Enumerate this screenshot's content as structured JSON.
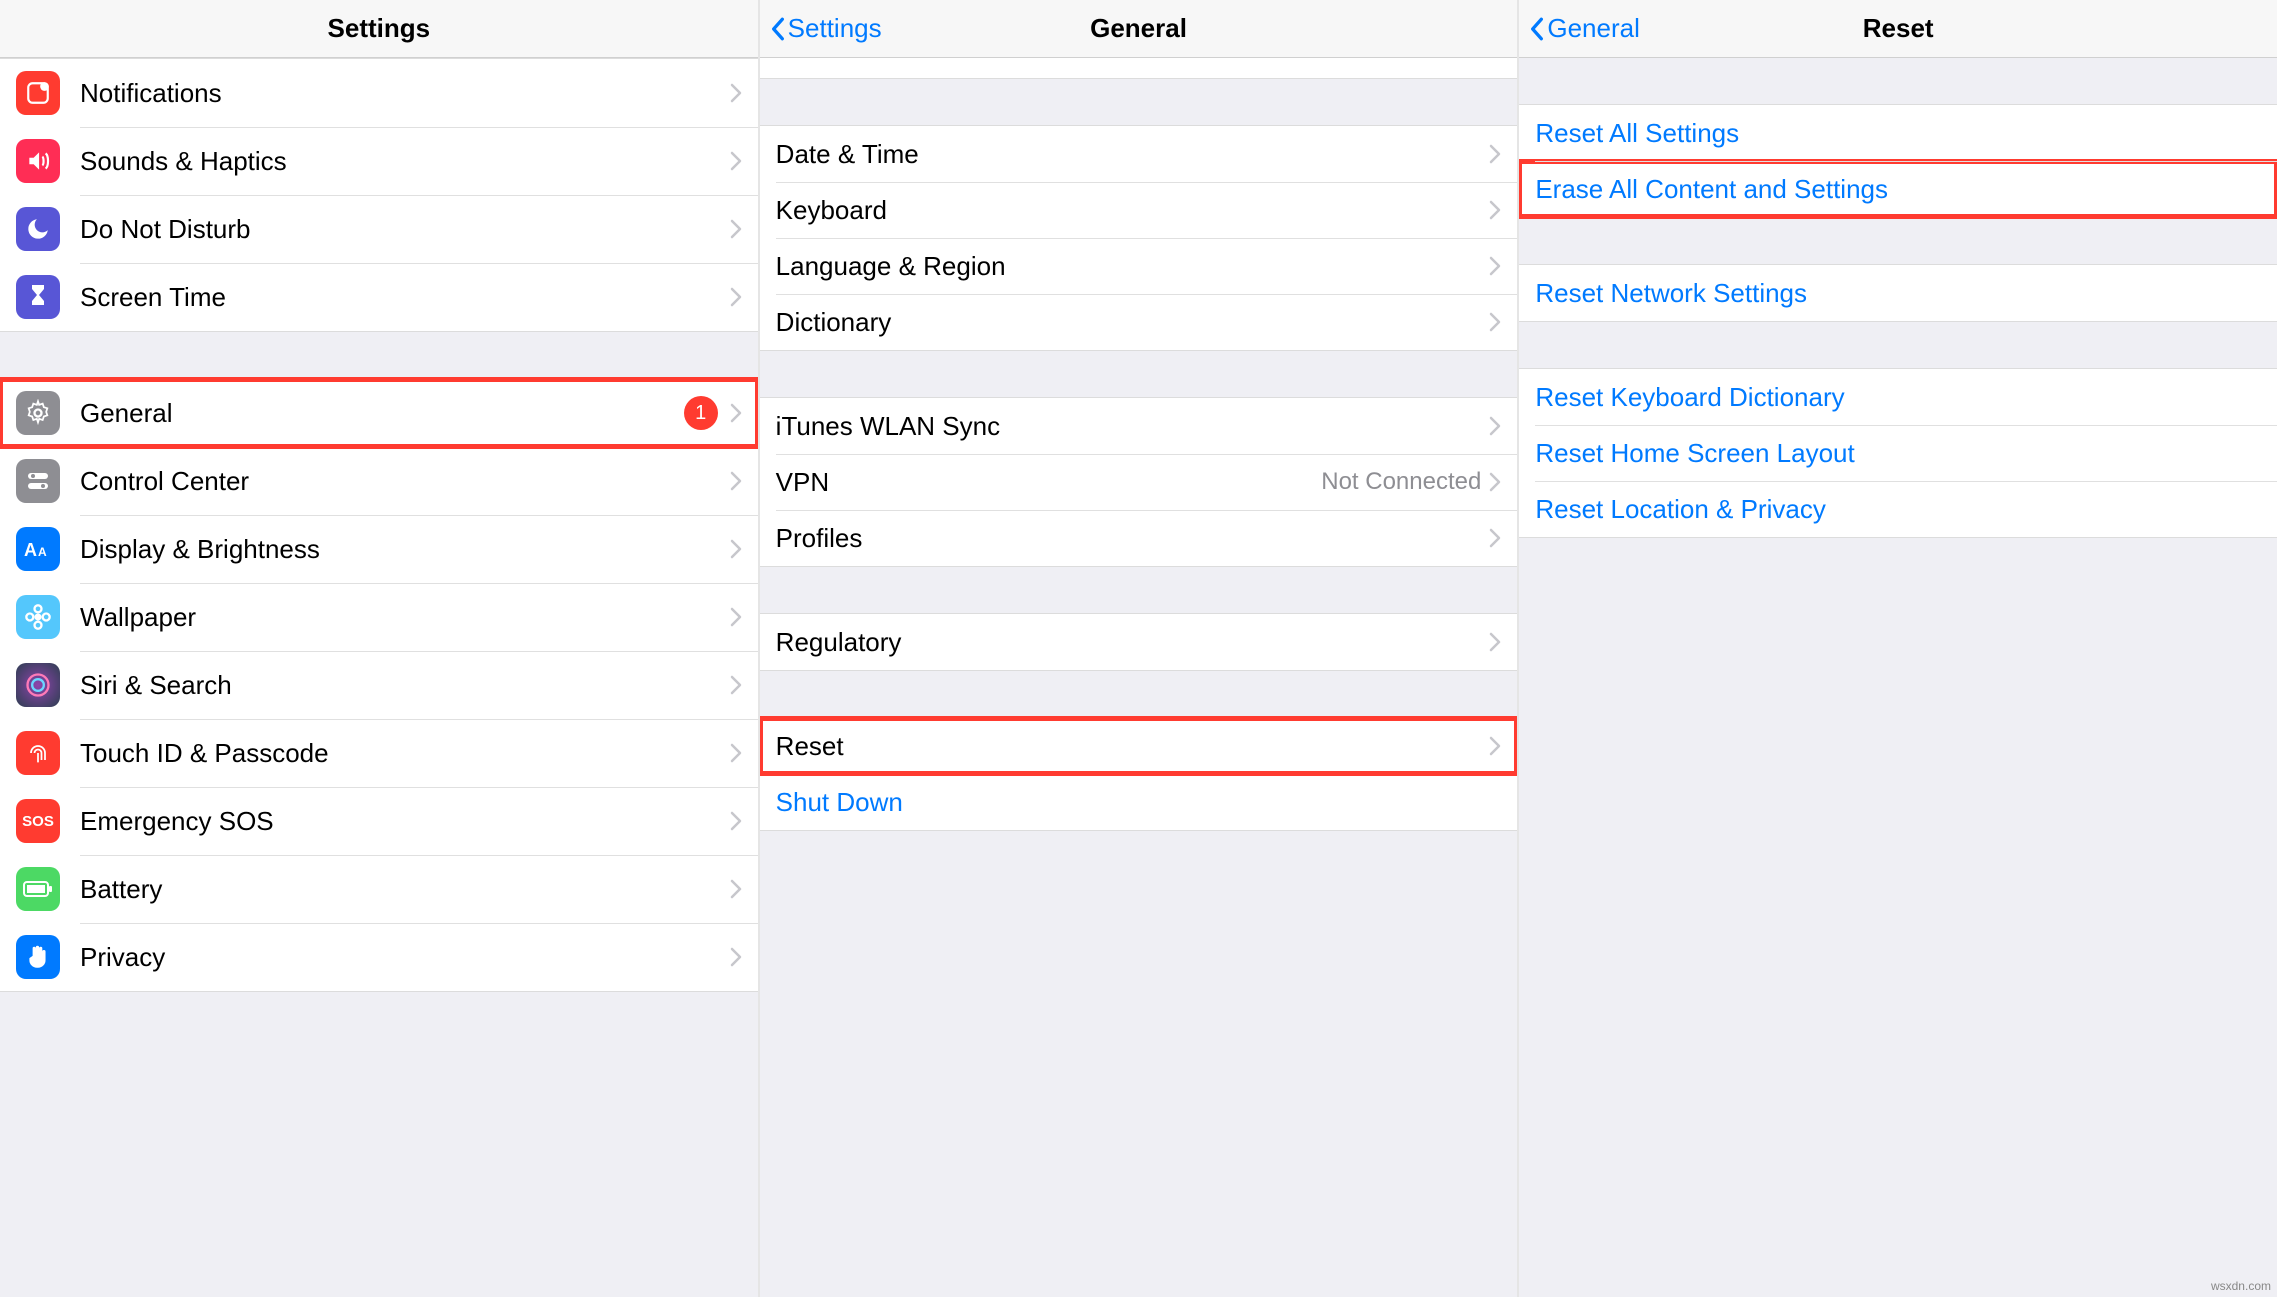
{
  "panel1": {
    "title": "Settings",
    "items": [
      {
        "label": "Notifications"
      },
      {
        "label": "Sounds & Haptics"
      },
      {
        "label": "Do Not Disturb"
      },
      {
        "label": "Screen Time"
      }
    ],
    "items2": [
      {
        "label": "General",
        "badge": "1"
      },
      {
        "label": "Control Center"
      },
      {
        "label": "Display & Brightness"
      },
      {
        "label": "Wallpaper"
      },
      {
        "label": "Siri & Search"
      },
      {
        "label": "Touch ID & Passcode"
      },
      {
        "label": "Emergency SOS"
      },
      {
        "label": "Battery"
      },
      {
        "label": "Privacy"
      }
    ]
  },
  "panel2": {
    "back": "Settings",
    "title": "General",
    "groupA": [
      {
        "label": "Date & Time"
      },
      {
        "label": "Keyboard"
      },
      {
        "label": "Language & Region"
      },
      {
        "label": "Dictionary"
      }
    ],
    "groupB": [
      {
        "label": "iTunes WLAN Sync"
      },
      {
        "label": "VPN",
        "detail": "Not Connected"
      },
      {
        "label": "Profiles"
      }
    ],
    "groupC": [
      {
        "label": "Regulatory"
      }
    ],
    "groupD": [
      {
        "label": "Reset"
      },
      {
        "label": "Shut Down"
      }
    ]
  },
  "panel3": {
    "back": "General",
    "title": "Reset",
    "groupA": [
      {
        "label": "Reset All Settings"
      },
      {
        "label": "Erase All Content and Settings"
      }
    ],
    "groupB": [
      {
        "label": "Reset Network Settings"
      }
    ],
    "groupC": [
      {
        "label": "Reset Keyboard Dictionary"
      },
      {
        "label": "Reset Home Screen Layout"
      },
      {
        "label": "Reset Location & Privacy"
      }
    ]
  },
  "watermark": "wsxdn.com"
}
